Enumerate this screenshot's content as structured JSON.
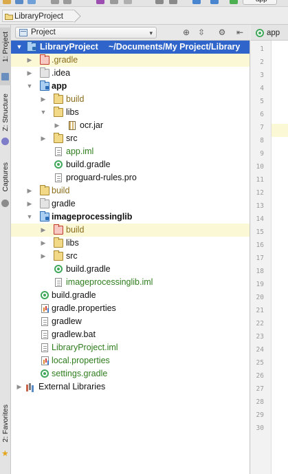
{
  "toolbar": {
    "run_config": "app"
  },
  "breadcrumb": {
    "project": "LibraryProject"
  },
  "left_strip": {
    "tabs": [
      {
        "label": "1: Project"
      },
      {
        "label": "Z: Structure"
      },
      {
        "label": "Captures"
      },
      {
        "label": "2: Favorites"
      }
    ]
  },
  "project_panel": {
    "view_mode": "Project"
  },
  "tree": {
    "root_label": "LibraryProject",
    "root_path": "~/Documents/My Project/Library",
    "items": [
      {
        "label": ".gradle"
      },
      {
        "label": ".idea"
      },
      {
        "label": "app"
      },
      {
        "label": "build"
      },
      {
        "label": "libs"
      },
      {
        "label": "ocr.jar"
      },
      {
        "label": "src"
      },
      {
        "label": "app.iml"
      },
      {
        "label": "build.gradle"
      },
      {
        "label": "proguard-rules.pro"
      },
      {
        "label": "build"
      },
      {
        "label": "gradle"
      },
      {
        "label": "imageprocessinglib"
      },
      {
        "label": "build"
      },
      {
        "label": "libs"
      },
      {
        "label": "src"
      },
      {
        "label": "build.gradle"
      },
      {
        "label": "imageprocessinglib.iml"
      },
      {
        "label": "build.gradle"
      },
      {
        "label": "gradle.properties"
      },
      {
        "label": "gradlew"
      },
      {
        "label": "gradlew.bat"
      },
      {
        "label": "LibraryProject.iml"
      },
      {
        "label": "local.properties"
      },
      {
        "label": "settings.gradle"
      },
      {
        "label": "External Libraries"
      }
    ]
  },
  "editor": {
    "tab_label": "app",
    "line_numbers": [
      "1",
      "2",
      "3",
      "4",
      "5",
      "6",
      "7",
      "8",
      "9",
      "10",
      "11",
      "12",
      "13",
      "14",
      "15",
      "16",
      "17",
      "18",
      "19",
      "20",
      "21",
      "22",
      "23",
      "24",
      "25",
      "26",
      "27",
      "28",
      "29",
      "30"
    ]
  }
}
